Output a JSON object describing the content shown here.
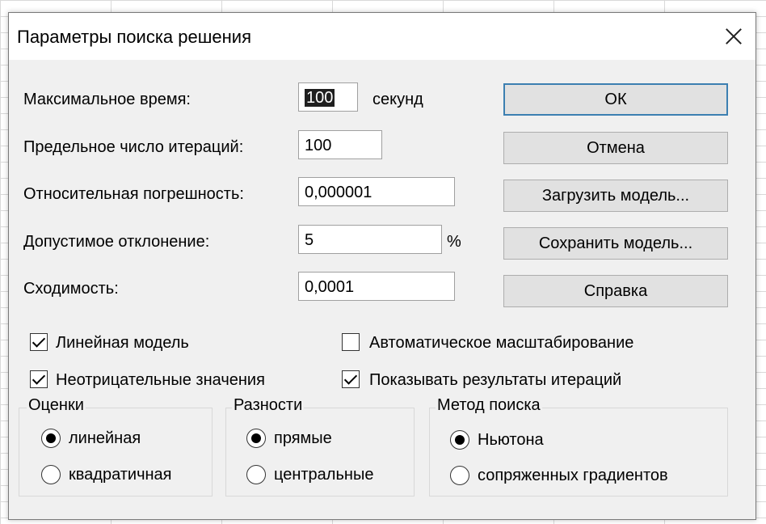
{
  "title": "Параметры поиска решения",
  "fields": {
    "max_time": {
      "label": "Максимальное время:",
      "value": "100",
      "unit": "секунд"
    },
    "iterations": {
      "label": "Предельное число итераций:",
      "value": "100"
    },
    "precision": {
      "label": "Относительная погрешность:",
      "value": "0,000001"
    },
    "tolerance": {
      "label": "Допустимое отклонение:",
      "value": "5",
      "unit": "%"
    },
    "convergence": {
      "label": "Сходимость:",
      "value": "0,0001"
    }
  },
  "buttons": {
    "ok": "ОК",
    "cancel": "Отмена",
    "load": "Загрузить модель...",
    "save": "Сохранить модель...",
    "help": "Справка"
  },
  "checkboxes": {
    "linear": {
      "label": "Линейная модель",
      "checked": true
    },
    "nonneg": {
      "label": "Неотрицательные значения",
      "checked": true
    },
    "autoscale": {
      "label": "Автоматическое масштабирование",
      "checked": false
    },
    "show_iter": {
      "label": "Показывать результаты итераций",
      "checked": true
    }
  },
  "groups": {
    "estimates": {
      "label": "Оценки",
      "options": [
        "линейная",
        "квадратичная"
      ],
      "selected": 0
    },
    "derivatives": {
      "label": "Разности",
      "options": [
        "прямые",
        "центральные"
      ],
      "selected": 0
    },
    "search": {
      "label": "Метод поиска",
      "options": [
        "Ньютона",
        "сопряженных градиентов"
      ],
      "selected": 0
    }
  }
}
